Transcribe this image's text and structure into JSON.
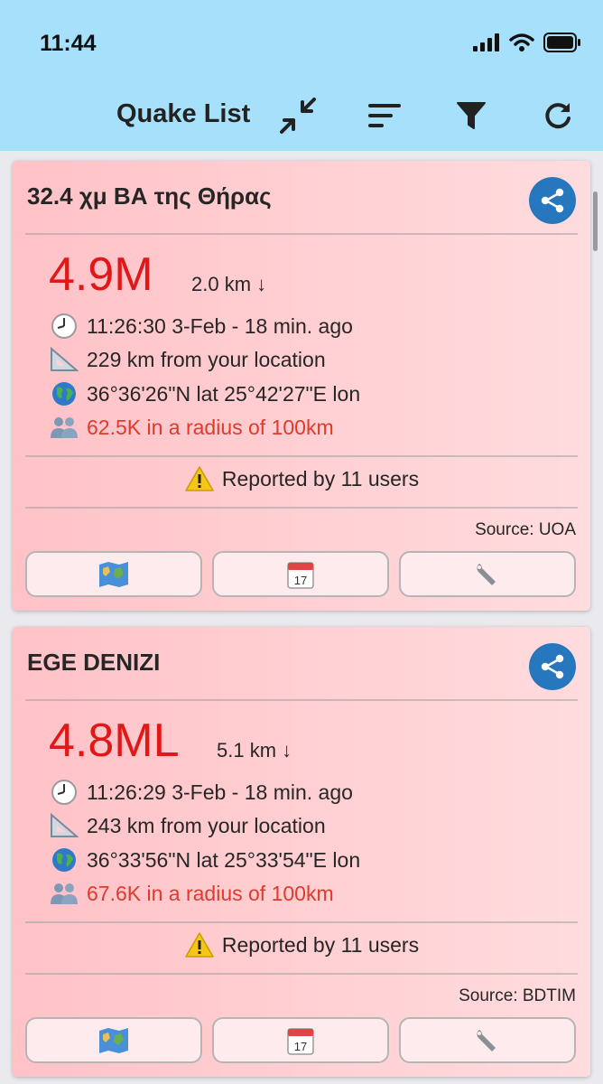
{
  "status": {
    "time": "11:44"
  },
  "header": {
    "title": "Quake List",
    "icons": [
      "collapse-icon",
      "sort-icon",
      "filter-icon",
      "refresh-icon"
    ],
    "background": "#a6e0fb"
  },
  "cards": [
    {
      "title": "32.4 χμ ΒΑ της Θήρας",
      "magnitude": "4.9M",
      "depth": "2.0 km ↓",
      "time": "11:26:30 3-Feb - 18 min. ago",
      "distance": "229 km from your location",
      "coords": "36°36'26\"N lat 25°42'27\"E lon",
      "population": "62.5K in a radius of 100km",
      "reported": "Reported by 11 users",
      "source": "Source: UOA"
    },
    {
      "title": "EGE DENIZI",
      "magnitude": "4.8ML",
      "depth": "5.1 km ↓",
      "time": "11:26:29 3-Feb - 18 min. ago",
      "distance": "243 km from your location",
      "coords": "36°33'56\"N lat 25°33'54\"E lon",
      "population": "67.6K in a radius of 100km",
      "reported": "Reported by 11 users",
      "source": "Source: BDTIM"
    }
  ],
  "colors": {
    "magnitude": "#e01818",
    "population": "#e03a2a",
    "share": "#2677bd",
    "card_bg": "#ffc8cc"
  }
}
